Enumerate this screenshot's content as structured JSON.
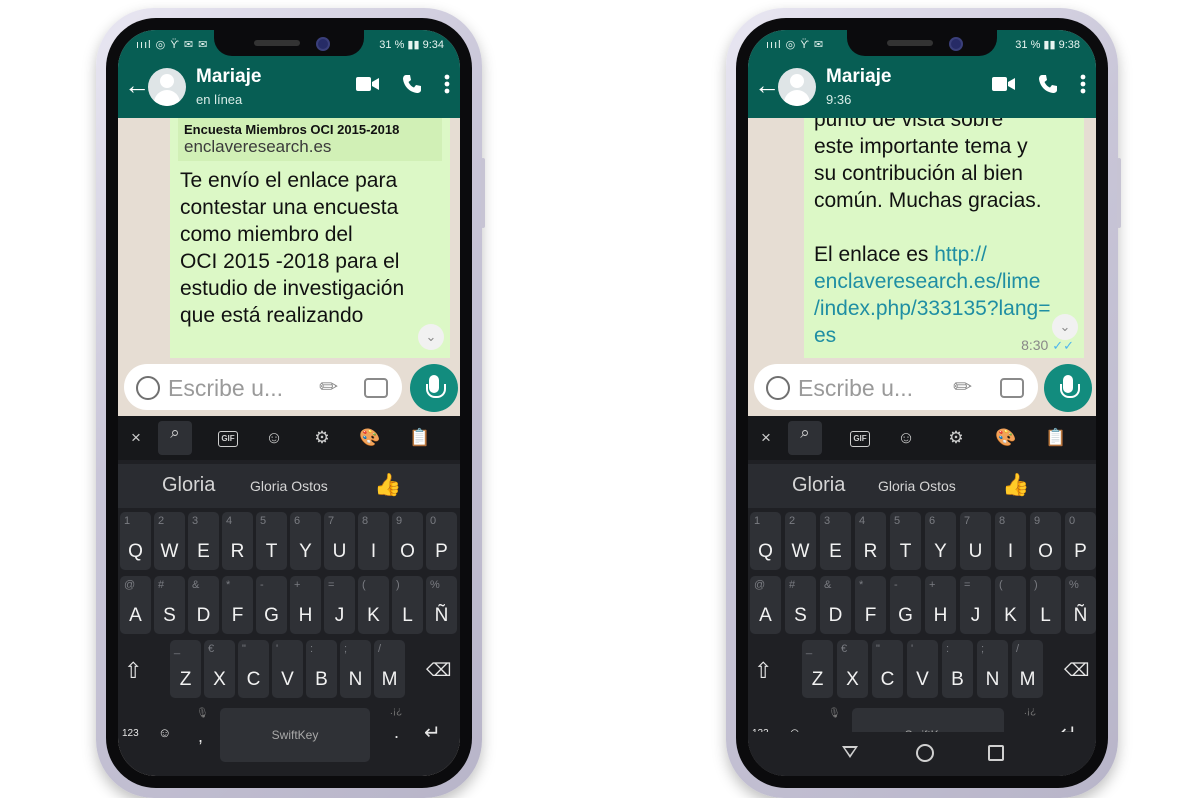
{
  "left": {
    "status": {
      "left": "ıııl ◎ ϔ ✉ ✉",
      "right": "31 % ▮▮ 9:34"
    },
    "contact": {
      "name": "Mariaje",
      "status": "en línea"
    },
    "link_title": "Encuesta Miembros OCI 2015-2018",
    "link_domain": "enclaveresearch.es",
    "message_lines": [
      "Te envío el enlace para",
      "contestar una encuesta",
      "como miembro del",
      "OCI 2015 -2018 para el",
      "estudio de investigación",
      "que está realizando"
    ],
    "input_placeholder": "Escribe u...",
    "suggestions": [
      "Gloria",
      "Gloria Ostos",
      "👍"
    ],
    "navigation": [
      "▽",
      "○",
      "□"
    ]
  },
  "right": {
    "status": {
      "left": "ıııl ◎ ϔ ✉",
      "right": "31 % ▮▮ 9:38"
    },
    "contact": {
      "name": "Mariaje",
      "status": "9:36"
    },
    "message_lines": [
      "punto de vista sobre",
      "este importante tema y",
      "su contribución al bien",
      "común.  Muchas gracias.",
      "",
      "El enlace es http://",
      "enclaveresearch.es/lime",
      "/index.php/333135?lang=",
      "es"
    ],
    "link_prefix": "El enlace es ",
    "timestamp": "8:30",
    "input_placeholder": "Escribe u...",
    "suggestions": [
      "Gloria",
      "Gloria Ostos",
      "👍"
    ]
  },
  "keyboard": {
    "toolbar": [
      "×",
      "⌕",
      "GIF",
      "☺",
      "⚙",
      "🎨",
      "📋"
    ],
    "rows": [
      [
        [
          "1",
          "Q"
        ],
        [
          "2",
          "W"
        ],
        [
          "3",
          "E"
        ],
        [
          "4",
          "R"
        ],
        [
          "5",
          "T"
        ],
        [
          "6",
          "Y"
        ],
        [
          "7",
          "U"
        ],
        [
          "8",
          "I"
        ],
        [
          "9",
          "O"
        ],
        [
          "0",
          "P"
        ]
      ],
      [
        [
          "@",
          "A"
        ],
        [
          "#",
          "S"
        ],
        [
          "&",
          "D"
        ],
        [
          "*",
          "F"
        ],
        [
          "-",
          "G"
        ],
        [
          "+",
          "H"
        ],
        [
          "=",
          "J"
        ],
        [
          "(",
          "K"
        ],
        [
          ")",
          "L"
        ],
        [
          "%",
          "Ñ"
        ]
      ],
      [
        [
          "_",
          "Z"
        ],
        [
          "€",
          "X"
        ],
        [
          "\"",
          "C"
        ],
        [
          "'",
          "V"
        ],
        [
          ":",
          "B"
        ],
        [
          ";",
          "N"
        ],
        [
          "/",
          "M"
        ]
      ]
    ],
    "shift": "⇧",
    "backspace": "⌫",
    "num_key": "123",
    "emoji_key": "☺",
    "comma": ",",
    "period": ".",
    "space_label": "SwiftKey",
    "enter": "↵",
    "mic_hint": "🎙",
    "punct_hint": ".¡¿"
  },
  "nav": {
    "back": "▽",
    "home": "○",
    "recent": "□"
  },
  "colors": {
    "header": "#075e54",
    "bubble": "#dcf8c6",
    "accent": "#128c7e",
    "keyboard": "#1f2024"
  }
}
